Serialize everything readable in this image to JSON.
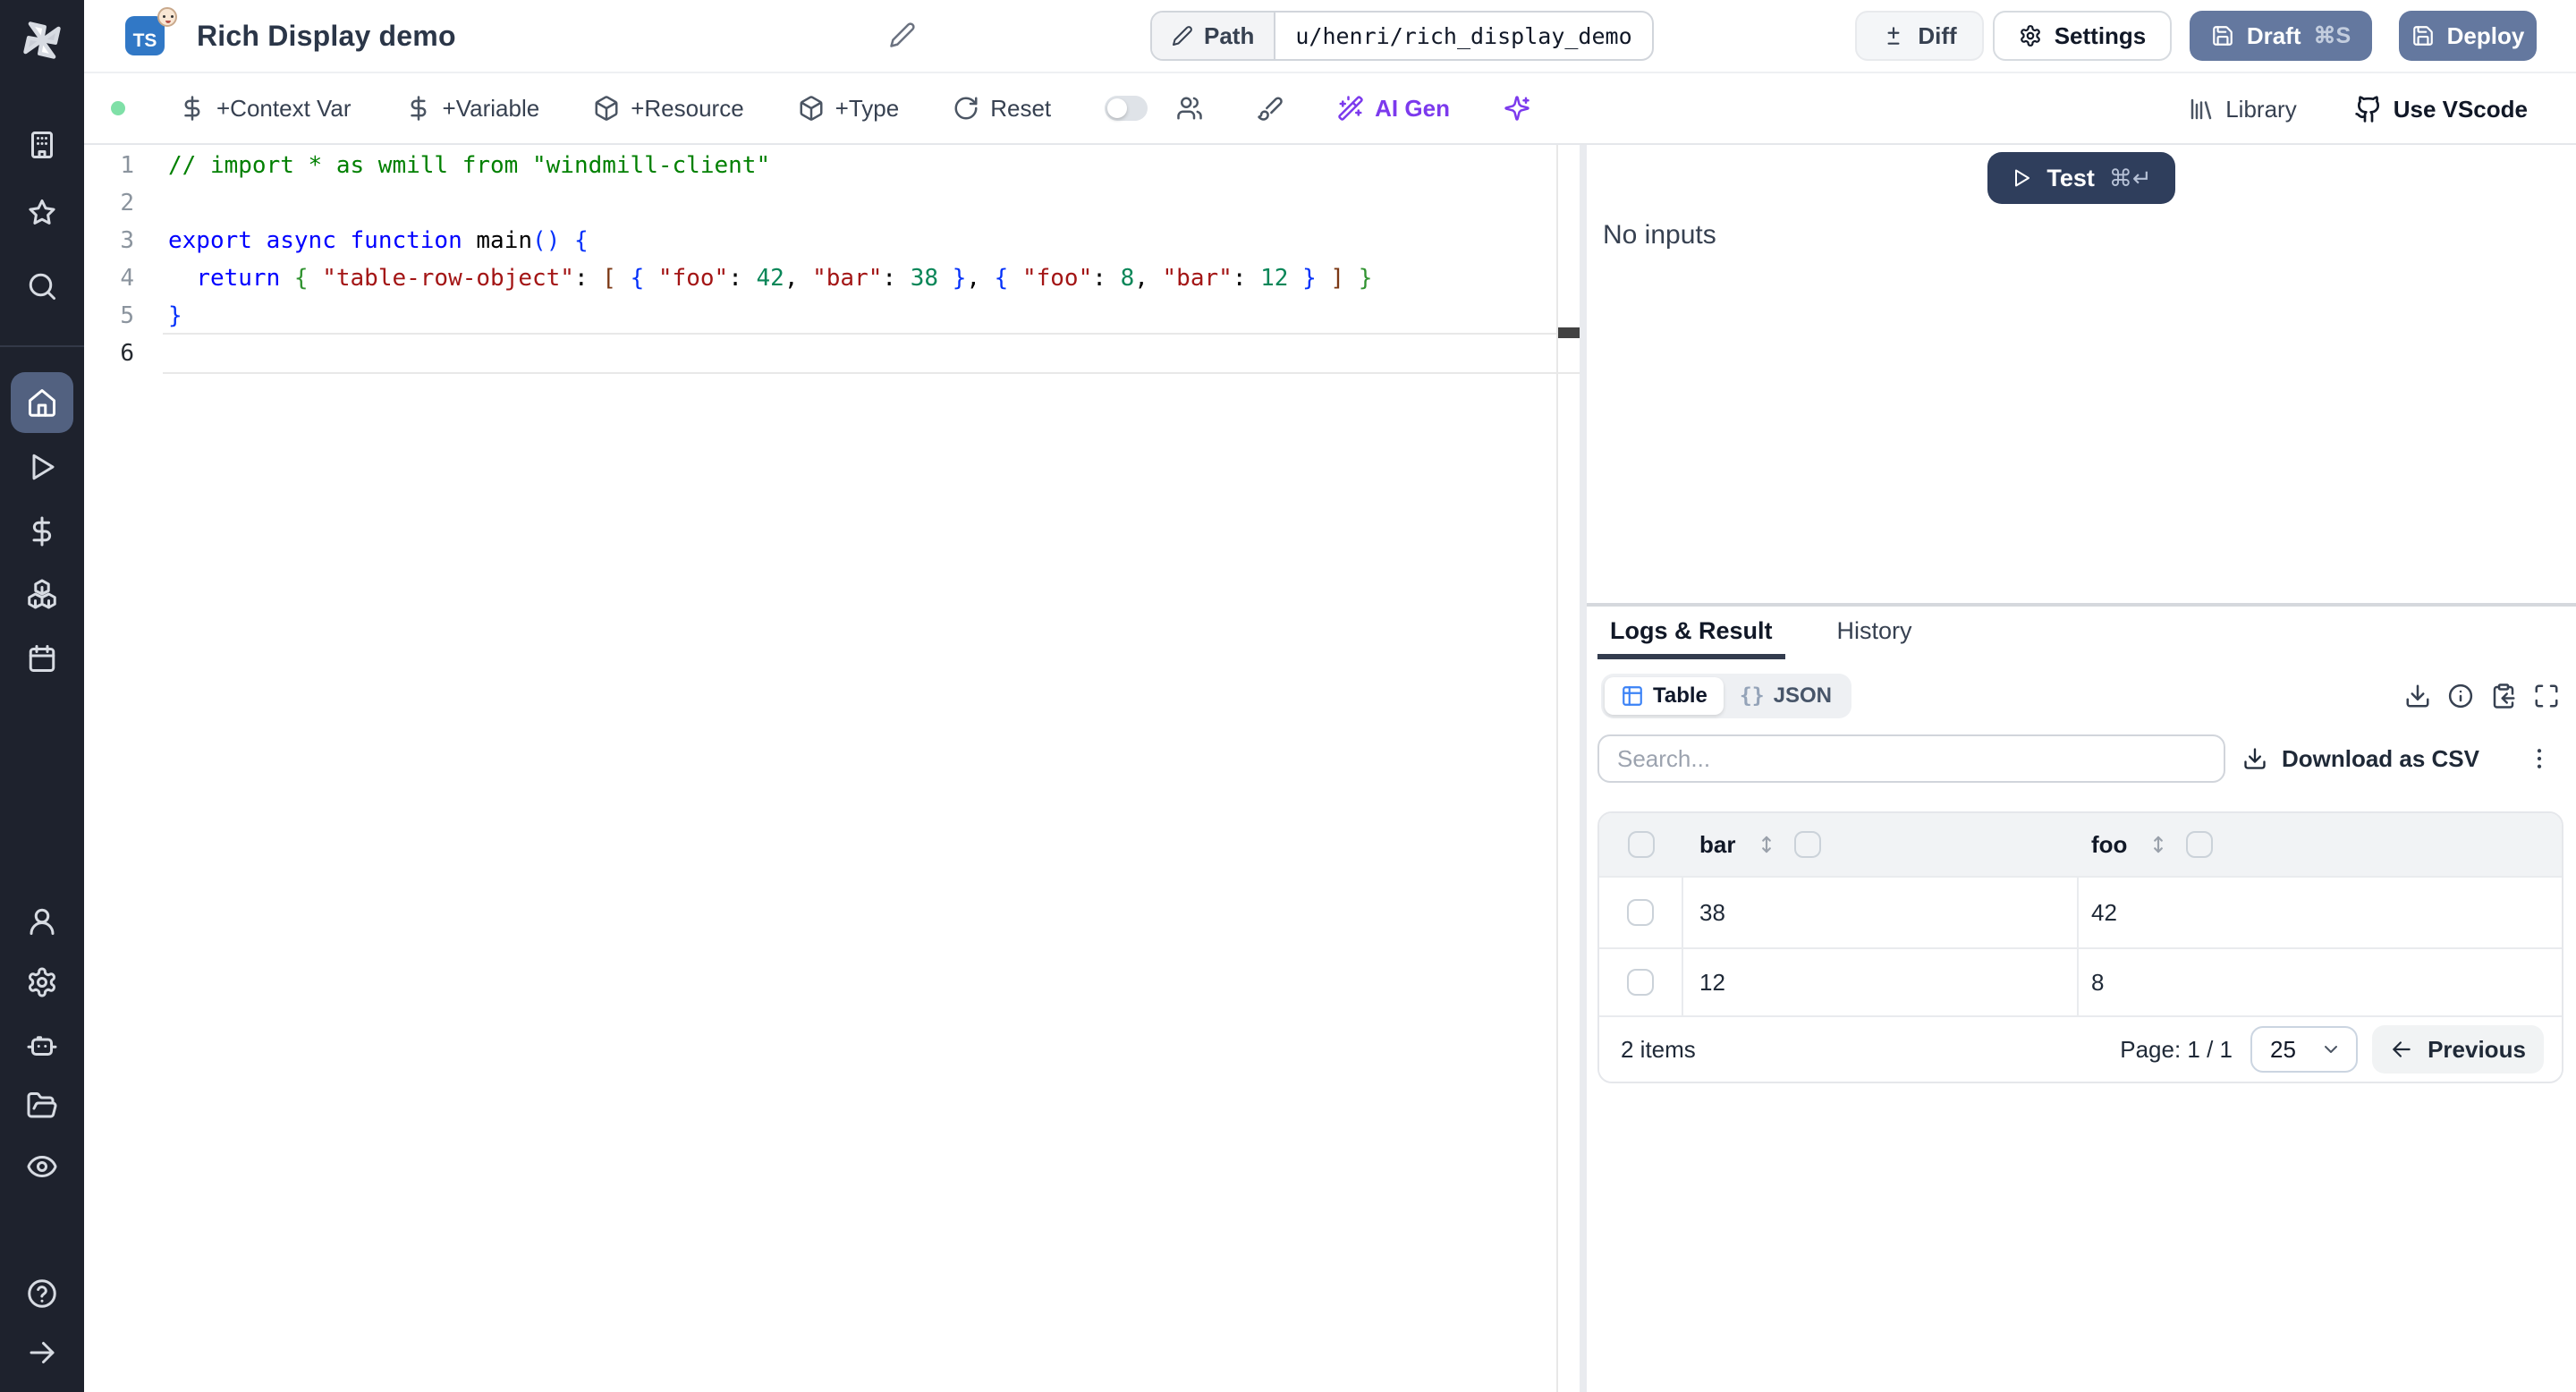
{
  "topbar": {
    "title": "Rich Display demo",
    "lang_badge": "TS",
    "lang_badge_icon": "typescript-baby-face-badge",
    "path_label": "Path",
    "path_value": "u/henri/rich_display_demo",
    "diff_label": "Diff",
    "settings_label": "Settings",
    "draft_label": "Draft",
    "draft_shortcut": "⌘S",
    "deploy_label": "Deploy"
  },
  "toolbar": {
    "context_var": "+Context Var",
    "variable": "+Variable",
    "resource": "+Resource",
    "type": "+Type",
    "reset": "Reset",
    "ai_gen": "AI Gen",
    "library": "Library",
    "vscode": "Use VScode"
  },
  "sidebar_icons": [
    "windmill-logo",
    "building",
    "star",
    "search",
    "home",
    "play",
    "dollar-sign",
    "boxes",
    "calendar",
    "user",
    "settings-gear",
    "robot",
    "folder-open",
    "eye",
    "help-circle",
    "arrow-right"
  ],
  "editor": {
    "active_line": 6,
    "lines": [
      [
        [
          "// import * as wmill from \"windmill-client\"",
          "c"
        ]
      ],
      [],
      [
        [
          "export",
          "k"
        ],
        [
          " ",
          "p"
        ],
        [
          "async",
          "k"
        ],
        [
          " ",
          "p"
        ],
        [
          "function",
          "k"
        ],
        [
          " ",
          "p"
        ],
        [
          "main",
          "f"
        ],
        [
          "(",
          "b1"
        ],
        [
          ")",
          "b1"
        ],
        [
          " ",
          "p"
        ],
        [
          "{",
          "b1"
        ]
      ],
      [
        [
          "  ",
          "p"
        ],
        [
          "return",
          "k"
        ],
        [
          " ",
          "p"
        ],
        [
          "{",
          "b2"
        ],
        [
          " ",
          "p"
        ],
        [
          "\"table-row-object\"",
          "s"
        ],
        [
          ":",
          "p"
        ],
        [
          " ",
          "p"
        ],
        [
          "[",
          "b3"
        ],
        [
          " ",
          "p"
        ],
        [
          "{",
          "b1"
        ],
        [
          " ",
          "p"
        ],
        [
          "\"foo\"",
          "s"
        ],
        [
          ":",
          "p"
        ],
        [
          " ",
          "p"
        ],
        [
          "42",
          "n"
        ],
        [
          ",",
          "p"
        ],
        [
          " ",
          "p"
        ],
        [
          "\"bar\"",
          "s"
        ],
        [
          ":",
          "p"
        ],
        [
          " ",
          "p"
        ],
        [
          "38",
          "n"
        ],
        [
          " ",
          "p"
        ],
        [
          "}",
          "b1"
        ],
        [
          ",",
          "p"
        ],
        [
          " ",
          "p"
        ],
        [
          "{",
          "b1"
        ],
        [
          " ",
          "p"
        ],
        [
          "\"foo\"",
          "s"
        ],
        [
          ":",
          "p"
        ],
        [
          " ",
          "p"
        ],
        [
          "8",
          "n"
        ],
        [
          ",",
          "p"
        ],
        [
          " ",
          "p"
        ],
        [
          "\"bar\"",
          "s"
        ],
        [
          ":",
          "p"
        ],
        [
          " ",
          "p"
        ],
        [
          "12",
          "n"
        ],
        [
          " ",
          "p"
        ],
        [
          "}",
          "b1"
        ],
        [
          " ",
          "p"
        ],
        [
          "]",
          "b3"
        ],
        [
          " ",
          "p"
        ],
        [
          "}",
          "b2"
        ]
      ],
      [
        [
          "}",
          "b1"
        ]
      ],
      []
    ]
  },
  "runner": {
    "test_label": "Test",
    "test_shortcut": "⌘↵",
    "no_inputs": "No inputs"
  },
  "result": {
    "tabs": {
      "logs": "Logs & Result",
      "history": "History"
    },
    "view": {
      "table": "Table",
      "json_icon": "{}",
      "json": "JSON"
    },
    "search_placeholder": "Search...",
    "download_csv": "Download as CSV",
    "table": {
      "columns": [
        "bar",
        "foo"
      ],
      "rows": [
        [
          "38",
          "42"
        ],
        [
          "12",
          "8"
        ]
      ],
      "items_label": "2 items",
      "page_label": "Page: 1 / 1",
      "page_size": "25",
      "previous_label": "Previous"
    }
  },
  "colors": {
    "sidebar_bg": "#1e222d",
    "sidebar_active": "#526180",
    "slate_button": "#64789f",
    "test_button": "#2f3e5c",
    "ai_purple": "#7c3aed",
    "ts_blue": "#3178c6",
    "status_green": "#7fe0a7",
    "table_icon": "#3b82f6",
    "tab_underline": "#333c4e"
  }
}
